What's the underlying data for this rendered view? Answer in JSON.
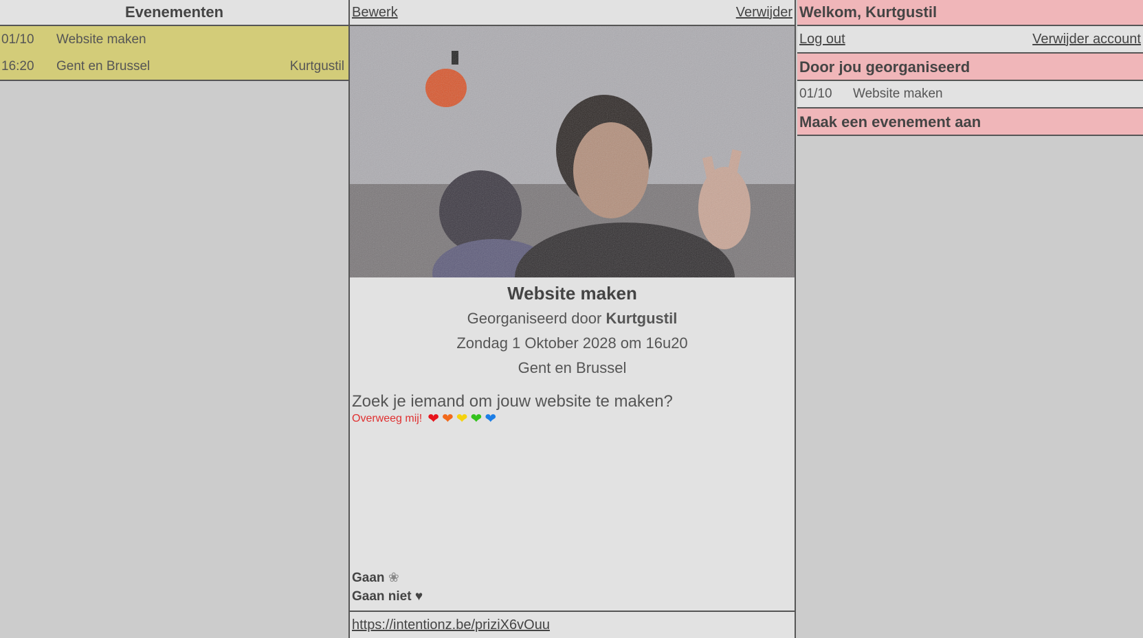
{
  "sidebar": {
    "title": "Evenementen",
    "events": [
      {
        "date": "01/10",
        "time": "16:20",
        "name": "Website maken",
        "location": "Gent en Brussel",
        "organizer": "Kurtgustil"
      }
    ]
  },
  "event": {
    "edit_label": "Bewerk",
    "delete_label": "Verwijder",
    "title": "Website maken",
    "organized_prefix": "Georganiseerd door",
    "organizer": "Kurtgustil",
    "datetime": "Zondag 1 Oktober 2028 om 16u20",
    "location": "Gent en Brussel",
    "description": "Zoek je iemand om jouw website te maken?",
    "consider": "Overweeg mij!",
    "hearts": [
      "❤",
      "❤",
      "❤",
      "❤",
      "❤"
    ],
    "heart_colors": [
      "#e8141c",
      "#f2691b",
      "#f5d20f",
      "#33c21d",
      "#1c7ee6"
    ],
    "going_label": "Gaan",
    "going_icon": "❀",
    "not_going_label": "Gaan niet",
    "not_going_icon": "♥",
    "share_link": "https://intentionz.be/priziX6vOuu"
  },
  "account": {
    "welcome": "Welkom, Kurtgustil",
    "logout_label": "Log out",
    "delete_account_label": "Verwijder account",
    "organized_title": "Door jou georganiseerd",
    "organized": [
      {
        "date": "01/10",
        "name": "Website maken"
      }
    ],
    "create_label": "Maak een evenement aan"
  },
  "colors": {
    "event_row": "#d3cc79",
    "pink_header": "#f0b6b9",
    "panel": "#e2e2e2",
    "background": "#cccccc"
  }
}
